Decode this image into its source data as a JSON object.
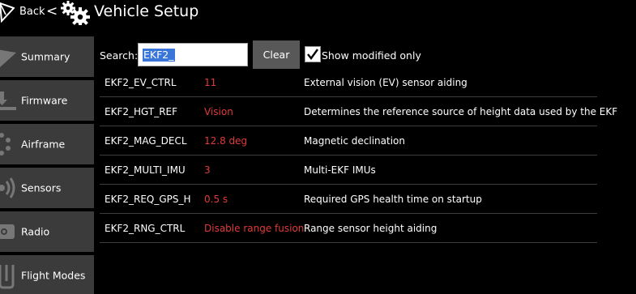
{
  "header": {
    "back_label": "Back",
    "separator": "<",
    "title": "Vehicle Setup"
  },
  "sidebar": {
    "items": [
      {
        "label": "Summary",
        "icon": "paper-plane-icon"
      },
      {
        "label": "Firmware",
        "icon": "download-icon"
      },
      {
        "label": "Airframe",
        "icon": "airframe-dots-icon"
      },
      {
        "label": "Sensors",
        "icon": "sensors-waves-icon"
      },
      {
        "label": "Radio",
        "icon": "radio-icon"
      },
      {
        "label": "Flight Modes",
        "icon": "flight-modes-icon"
      }
    ]
  },
  "search": {
    "label": "Search:",
    "value": "EKF2_",
    "clear_label": "Clear",
    "show_modified_label": "Show modified only",
    "show_modified_checked": true
  },
  "parameters": [
    {
      "name": "EKF2_EV_CTRL",
      "value": "11",
      "description": "External vision (EV) sensor aiding"
    },
    {
      "name": "EKF2_HGT_REF",
      "value": "Vision",
      "description": "Determines the reference source of height data used by the EKF"
    },
    {
      "name": "EKF2_MAG_DECL",
      "value": "12.8 deg",
      "description": "Magnetic declination"
    },
    {
      "name": "EKF2_MULTI_IMU",
      "value": "3",
      "description": "Multi-EKF IMUs"
    },
    {
      "name": "EKF2_REQ_GPS_H",
      "value": "0.5 s",
      "description": "Required GPS health time on startup"
    },
    {
      "name": "EKF2_RNG_CTRL",
      "value": "Disable range fusion",
      "description": "Range sensor height aiding"
    }
  ],
  "colors": {
    "modified_value": "#e03a3a",
    "sidebar_bg": "#3b3b3b",
    "clear_button_bg": "#585858",
    "selection": "#3a76d8"
  }
}
